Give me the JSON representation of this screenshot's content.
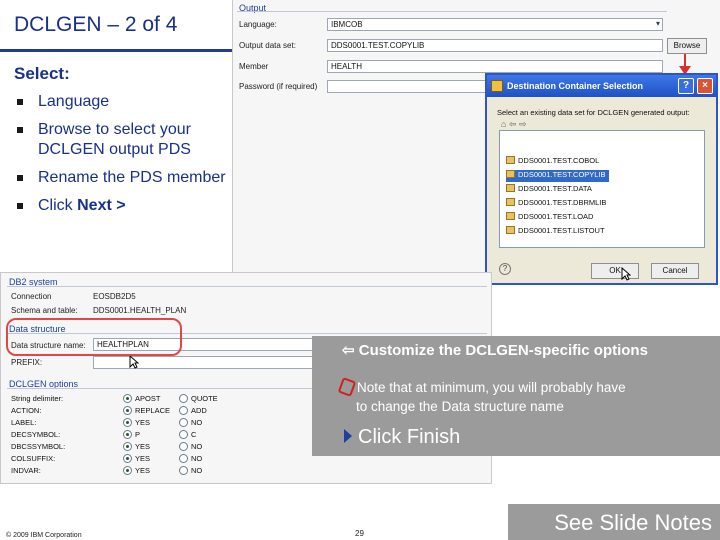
{
  "slide": {
    "title": "DCLGEN – 2 of 4",
    "select_label": "Select:",
    "bullets": [
      {
        "text": "Language",
        "bold": ""
      },
      {
        "text": "Browse to select your DCLGEN output PDS",
        "bold": ""
      },
      {
        "text": "Rename the PDS member",
        "bold": ""
      },
      {
        "text": "Click ",
        "bold": "Next >"
      }
    ]
  },
  "output_panel": {
    "group_title": "Output",
    "language_label": "Language:",
    "language_value": "IBMCOB",
    "dataset_label": "Output data set:",
    "dataset_value": "DDS0001.TEST.COPYLIB",
    "browse_label": "Browse",
    "member_label": "Member",
    "member_value": "HEALTH",
    "password_label": "Password (if required)"
  },
  "dialog": {
    "title": "Destination Container Selection",
    "prompt": "Select an existing data set for DCLGEN generated output:",
    "items": [
      "DDS0001.TEST.COBOL",
      "DDS0001.TEST.COPYLIB",
      "DDS0001.TEST.DATA",
      "DDS0001.TEST.DBRMLIB",
      "DDS0001.TEST.LOAD",
      "DDS0001.TEST.LISTOUT"
    ],
    "selected_index": 1,
    "ok_label": "OK",
    "cancel_label": "Cancel",
    "help_glyph": "?"
  },
  "db2_panel": {
    "group_title": "DB2 system",
    "connection_label": "Connection",
    "connection_value": "EOSDB2D5",
    "schema_label": "Schema and table:",
    "schema_value": "DDS0001.HEALTH_PLAN",
    "structure_group": "Data structure",
    "structure_name_label": "Data structure name:",
    "structure_name_value": "HEALTHPLAN",
    "prefix_label": "PREFIX:",
    "options_group": "DCLGEN options",
    "options": [
      {
        "label": "String delimiter:",
        "a": "APOST",
        "b": "QUOTE",
        "on": "a"
      },
      {
        "label": "ACTION:",
        "a": "REPLACE",
        "b": "ADD",
        "on": "a"
      },
      {
        "label": "LABEL:",
        "a": "YES",
        "b": "NO",
        "on": "a"
      },
      {
        "label": "DECSYMBOL:",
        "a": "P",
        "b": "C",
        "on": "a"
      },
      {
        "label": "DBCSSYMBOL:",
        "a": "YES",
        "b": "NO",
        "on": "a"
      },
      {
        "label": "COLSUFFIX:",
        "a": "YES",
        "b": "NO",
        "on": "a"
      },
      {
        "label": "INDVAR:",
        "a": "YES",
        "b": "NO",
        "on": "a"
      }
    ]
  },
  "callout": {
    "line1": "Customize the DCLGEN-specific options",
    "line2a": "Note that at minimum, you will probably have",
    "line2b": "to change the Data structure name",
    "line3": "Click Finish"
  },
  "footer": {
    "copyright": "© 2009 IBM Corporation",
    "page": "29",
    "notes": "See Slide Notes"
  },
  "colors": {
    "title_blue": "#17308a",
    "callout_gray": "#9b9b9b",
    "highlight_red": "#e04848",
    "selection_blue": "#316ac5"
  }
}
